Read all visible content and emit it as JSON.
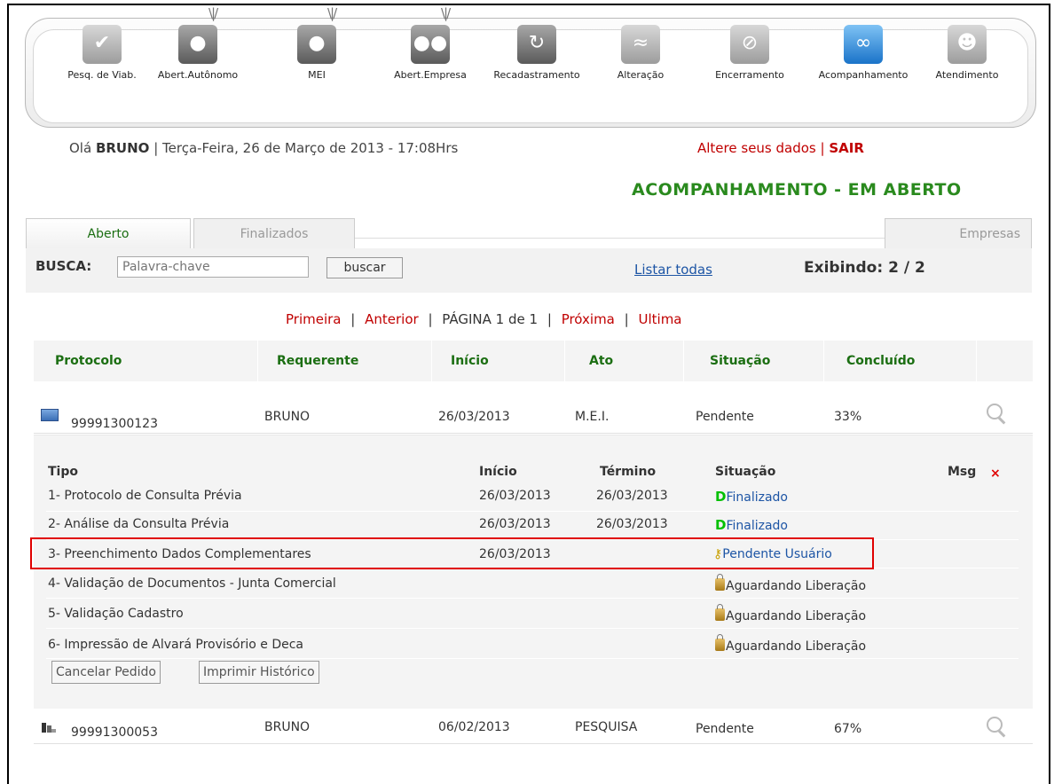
{
  "toolbar": {
    "items": [
      {
        "label": "Pesq. de Viab.",
        "icon": "viability-search-icon"
      },
      {
        "label": "Abert.Autônomo",
        "icon": "autonomous-opening-icon"
      },
      {
        "label": "MEI",
        "icon": "mei-icon"
      },
      {
        "label": "Abert.Empresa",
        "icon": "company-opening-icon"
      },
      {
        "label": "Recadastramento",
        "icon": "re-registration-icon"
      },
      {
        "label": "Alteração",
        "icon": "alteration-icon"
      },
      {
        "label": "Encerramento",
        "icon": "closure-icon"
      },
      {
        "label": "Acompanhamento",
        "icon": "binoculars-icon"
      },
      {
        "label": "Atendimento",
        "icon": "attendant-icon"
      }
    ]
  },
  "user": {
    "greeting": "Olá",
    "name": "BRUNO",
    "date": "| Terça-Feira, 26 de Março de 2013 - 17:08Hrs",
    "alter_label": "Altere seus dados",
    "sep": "|",
    "exit_label": "SAIR"
  },
  "page_title": "ACOMPANHAMENTO - EM ABERTO",
  "tabs": {
    "open": "Aberto",
    "finished": "Finalizados",
    "companies": "Empresas"
  },
  "search": {
    "label": "BUSCA:",
    "placeholder": "Palavra-chave",
    "button": "buscar",
    "list_all": "Listar todas",
    "showing": "Exibindo: 2 / 2"
  },
  "pager": {
    "first": "Primeira",
    "prev": "Anterior",
    "page": "PÁGINA 1 de 1",
    "next": "Próxima",
    "last": "Ultima",
    "sep": "|"
  },
  "table": {
    "headers": [
      "Protocolo",
      "Requerente",
      "Início",
      "Ato",
      "Situação",
      "Concluído"
    ],
    "rows": [
      {
        "protocol": "99991300123",
        "applicant": "BRUNO",
        "start": "26/03/2013",
        "act": "M.E.I.",
        "status": "Pendente",
        "done": "33%"
      },
      {
        "protocol": "99991300053",
        "applicant": "BRUNO",
        "start": "06/02/2013",
        "act": "PESQUISA",
        "status": "Pendente",
        "done": "67%"
      }
    ]
  },
  "detail": {
    "headers": {
      "type": "Tipo",
      "start": "Início",
      "end": "Término",
      "status": "Situação",
      "msg": "Msg",
      "close": "×"
    },
    "steps": [
      {
        "type": "1- Protocolo de Consulta Prévia",
        "start": "26/03/2013",
        "end": "26/03/2013",
        "status": "Finalizado"
      },
      {
        "type": "2- Análise da Consulta Prévia",
        "start": "26/03/2013",
        "end": "26/03/2013",
        "status": "Finalizado"
      },
      {
        "type": "3- Preenchimento Dados Complementares",
        "start": "26/03/2013",
        "end": "",
        "status": "Pendente Usuário"
      },
      {
        "type": "4- Validação de Documentos - Junta Comercial",
        "start": "",
        "end": "",
        "status": "Aguardando Liberação"
      },
      {
        "type": "5- Validação Cadastro",
        "start": "",
        "end": "",
        "status": "Aguardando Liberação"
      },
      {
        "type": "6- Impressão de Alvará Provisório e Deca",
        "start": "",
        "end": "",
        "status": "Aguardando Liberação"
      }
    ],
    "cancel_button": "Cancelar Pedido",
    "print_button": "Imprimir Histórico",
    "finished_glyph": "D"
  }
}
